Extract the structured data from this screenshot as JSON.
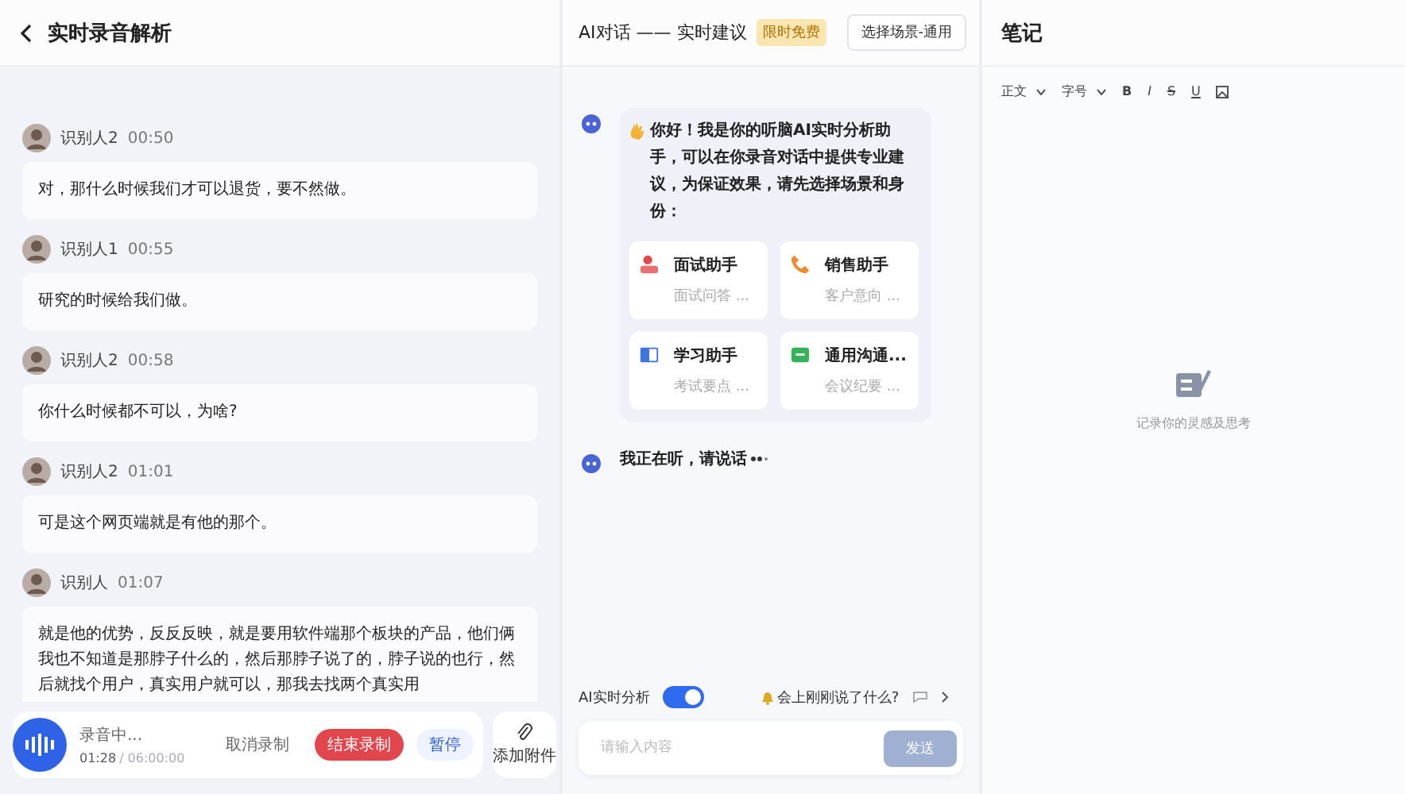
{
  "transcript": {
    "title": "实时录音解析",
    "messages": [
      {
        "speaker": "识别人2",
        "time": "00:50",
        "text": "对，那什么时候我们才可以退货，要不然做。"
      },
      {
        "speaker": "识别人1",
        "time": "00:55",
        "text": "研究的时候给我们做。"
      },
      {
        "speaker": "识别人2",
        "time": "00:58",
        "text": "你什么时候都不可以，为啥?"
      },
      {
        "speaker": "识别人2",
        "time": "01:01",
        "text": "可是这个网页端就是有他的那个。"
      },
      {
        "speaker": "识别人",
        "time": "01:07",
        "text": "就是他的优势，反反反映，就是要用软件端那个板块的产品，他们俩我也不知道是那脖子什么的，然后那脖子说了的，脖子说的也行，然后就找个用户，真实用户就可以，那我去找两个真实用"
      }
    ]
  },
  "recorder": {
    "status": "录音中...",
    "elapsed": "01:28",
    "total": "/ 06:00:00",
    "buttons": [
      {
        "kind": "cancel",
        "label": "取消录制"
      },
      {
        "kind": "stop",
        "label": "结束录制"
      },
      {
        "kind": "pause",
        "label": "暂停"
      }
    ],
    "attach_label": "添加附件"
  },
  "ai_chat": {
    "title": "AI对话 —— 实时建议",
    "badge": "限时免费",
    "scene_button": "选择场景-通用",
    "greeting": "你好！我是你的听脑AI实时分析助手，可以在你录音对话中提供专业建议，为保证效果，请先选择场景和身份：",
    "scenes": [
      {
        "kind": "interview",
        "title": "面试助手",
        "subtitle": "面试问答 ..."
      },
      {
        "kind": "sales",
        "title": "销售助手",
        "subtitle": "客户意向 ..."
      },
      {
        "kind": "study",
        "title": "学习助手",
        "subtitle": "考试要点 ..."
      },
      {
        "kind": "general",
        "title": "通用沟通...",
        "subtitle": "会议纪要 ..."
      }
    ],
    "listening": "我正在听，请说话",
    "realtime": {
      "label": "AI实时分析",
      "on": true
    },
    "suggestion": "会上刚刚说了什么?",
    "input": {
      "placeholder": "请输入内容",
      "send": "发送"
    }
  },
  "notes": {
    "title": "笔记",
    "toolbar": [
      {
        "kind": "dropdown",
        "label": "正文"
      },
      {
        "kind": "dropdown",
        "label": "字号"
      },
      {
        "kind": "bold",
        "label": "B"
      },
      {
        "kind": "italic",
        "label": "I"
      },
      {
        "kind": "strike",
        "label": "S"
      },
      {
        "kind": "underline",
        "label": "U"
      },
      {
        "kind": "image"
      }
    ],
    "empty": "记录你的灵感及思考"
  }
}
